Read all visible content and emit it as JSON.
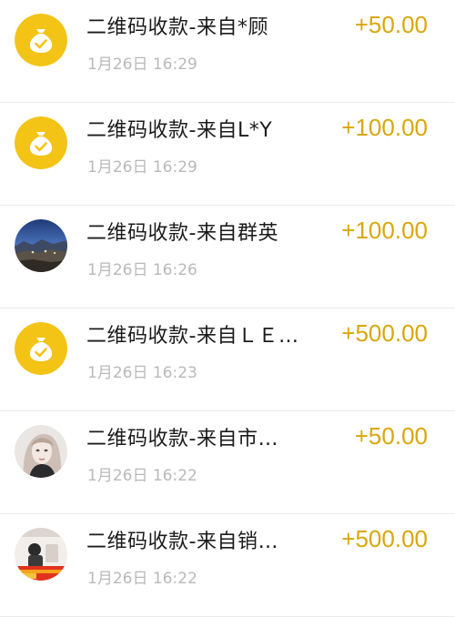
{
  "colors": {
    "amount": "#d9a70c",
    "money_icon_bg": "#f3c316",
    "title": "#1b1b1b",
    "time": "#b9b9b9"
  },
  "transactions": [
    {
      "title": "二维码收款-来自*顾",
      "time": "1月26日 16:29",
      "amount": "+50.00",
      "icon": "money-bag-icon"
    },
    {
      "title": "二维码收款-来自L*Y",
      "time": "1月26日 16:29",
      "amount": "+100.00",
      "icon": "money-bag-icon"
    },
    {
      "title": "二维码收款-来自群英",
      "time": "1月26日 16:26",
      "amount": "+100.00",
      "icon": "landscape-avatar"
    },
    {
      "title": "二维码收款-来自ＬＥ…",
      "time": "1月26日 16:23",
      "amount": "+500.00",
      "icon": "money-bag-icon"
    },
    {
      "title": "二维码收款-来自市…",
      "time": "1月26日 16:22",
      "amount": "+50.00",
      "icon": "portrait-avatar"
    },
    {
      "title": "二维码收款-来自销…",
      "time": "1月26日 16:22",
      "amount": "+500.00",
      "icon": "photo-avatar"
    }
  ]
}
